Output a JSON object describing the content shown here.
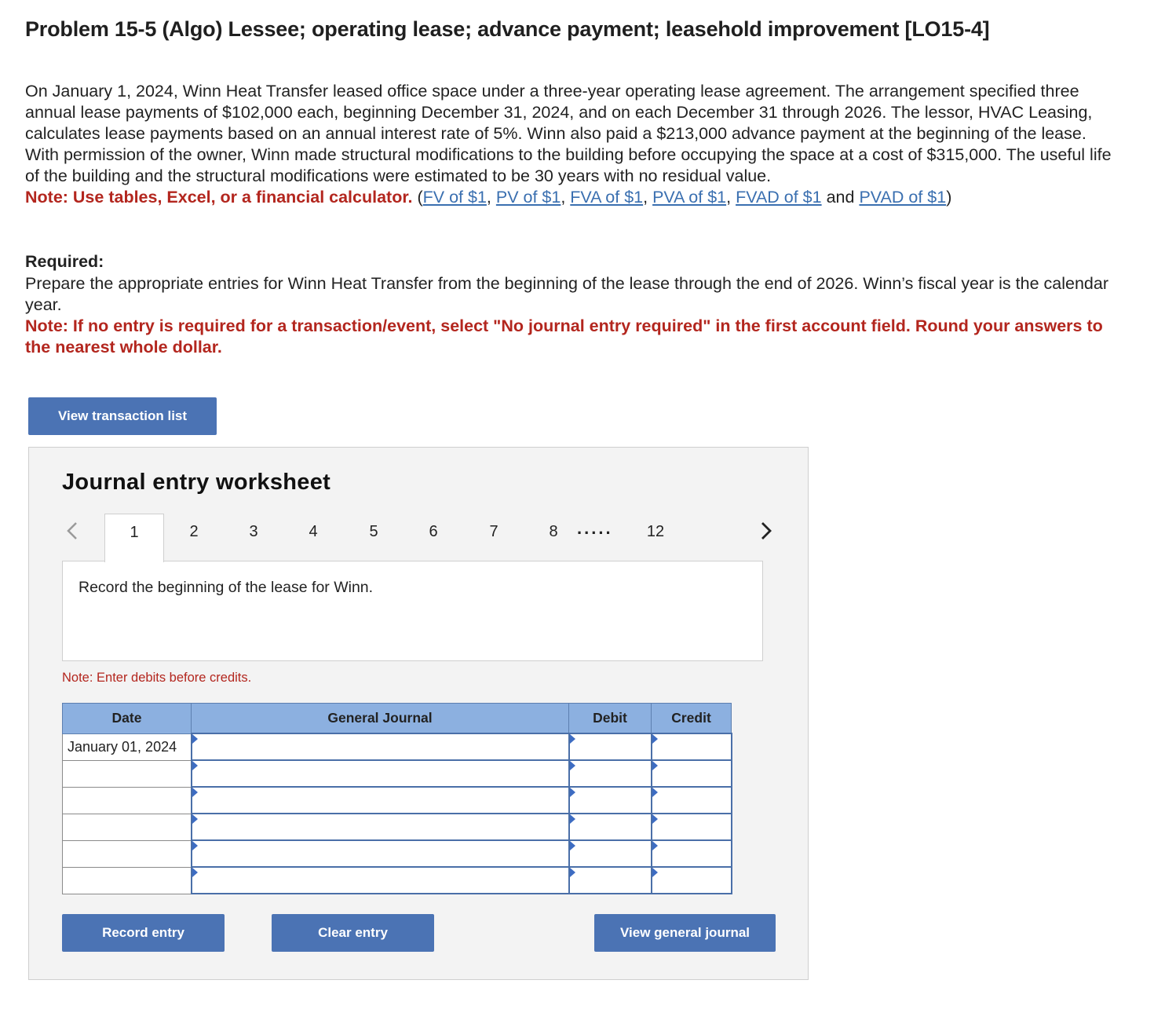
{
  "title": "Problem 15-5 (Algo) Lessee; operating lease; advance payment; leasehold improvement [LO15-4]",
  "problem_text": "On January 1, 2024, Winn Heat Transfer leased office space under a three-year operating lease agreement. The arrangement specified three annual lease payments of $102,000 each, beginning December 31, 2024, and on each December 31 through 2026. The lessor, HVAC Leasing, calculates lease payments based on an annual interest rate of 5%. Winn also paid a $213,000 advance payment at the beginning of the lease. With permission of the owner, Winn made structural modifications to the building before occupying the space at a cost of $315,000. The useful life of the building and the structural modifications were estimated to be 30 years with no residual value.",
  "tables_note": {
    "label": "Note: Use tables, Excel, or a financial calculator.",
    "open_paren": " (",
    "links": [
      "FV of $1",
      "PV of $1",
      "FVA of $1",
      "PVA of $1",
      "FVAD of $1",
      "PVAD of $1"
    ],
    "sep": ", ",
    "and": " and ",
    "close_paren": ")"
  },
  "required": {
    "label": "Required:",
    "text": "Prepare the appropriate entries for Winn Heat Transfer from the beginning of the lease through the end of 2026. Winn’s fiscal year is the calendar year.",
    "note": "Note: If no entry is required for a transaction/event, select \"No journal entry required\" in the first account field. Round your answers to the nearest whole dollar."
  },
  "buttons": {
    "view_transaction_list": "View transaction list",
    "record_entry": "Record entry",
    "clear_entry": "Clear entry",
    "view_general_journal": "View general journal"
  },
  "worksheet": {
    "title": "Journal entry worksheet",
    "tabs": [
      "1",
      "2",
      "3",
      "4",
      "5",
      "6",
      "7",
      "8",
      "12"
    ],
    "active_tab": "1",
    "ellipsis": ".....",
    "instruction": "Record the beginning of the lease for Winn.",
    "debits_note": "Note: Enter debits before credits.",
    "columns": [
      "Date",
      "General Journal",
      "Debit",
      "Credit"
    ],
    "rows": [
      {
        "date": "January 01, 2024",
        "account": "",
        "debit": "",
        "credit": ""
      },
      {
        "date": "",
        "account": "",
        "debit": "",
        "credit": ""
      },
      {
        "date": "",
        "account": "",
        "debit": "",
        "credit": ""
      },
      {
        "date": "",
        "account": "",
        "debit": "",
        "credit": ""
      },
      {
        "date": "",
        "account": "",
        "debit": "",
        "credit": ""
      },
      {
        "date": "",
        "account": "",
        "debit": "",
        "credit": ""
      }
    ]
  },
  "icons": {
    "prev": "chevron-left-icon",
    "next": "chevron-right-icon"
  },
  "colors": {
    "accent": "#4b73b4",
    "note_red": "#b3261e",
    "link": "#3a6fb0",
    "table_header": "#8cb0e0",
    "input_marker": "#3d6cc2"
  }
}
